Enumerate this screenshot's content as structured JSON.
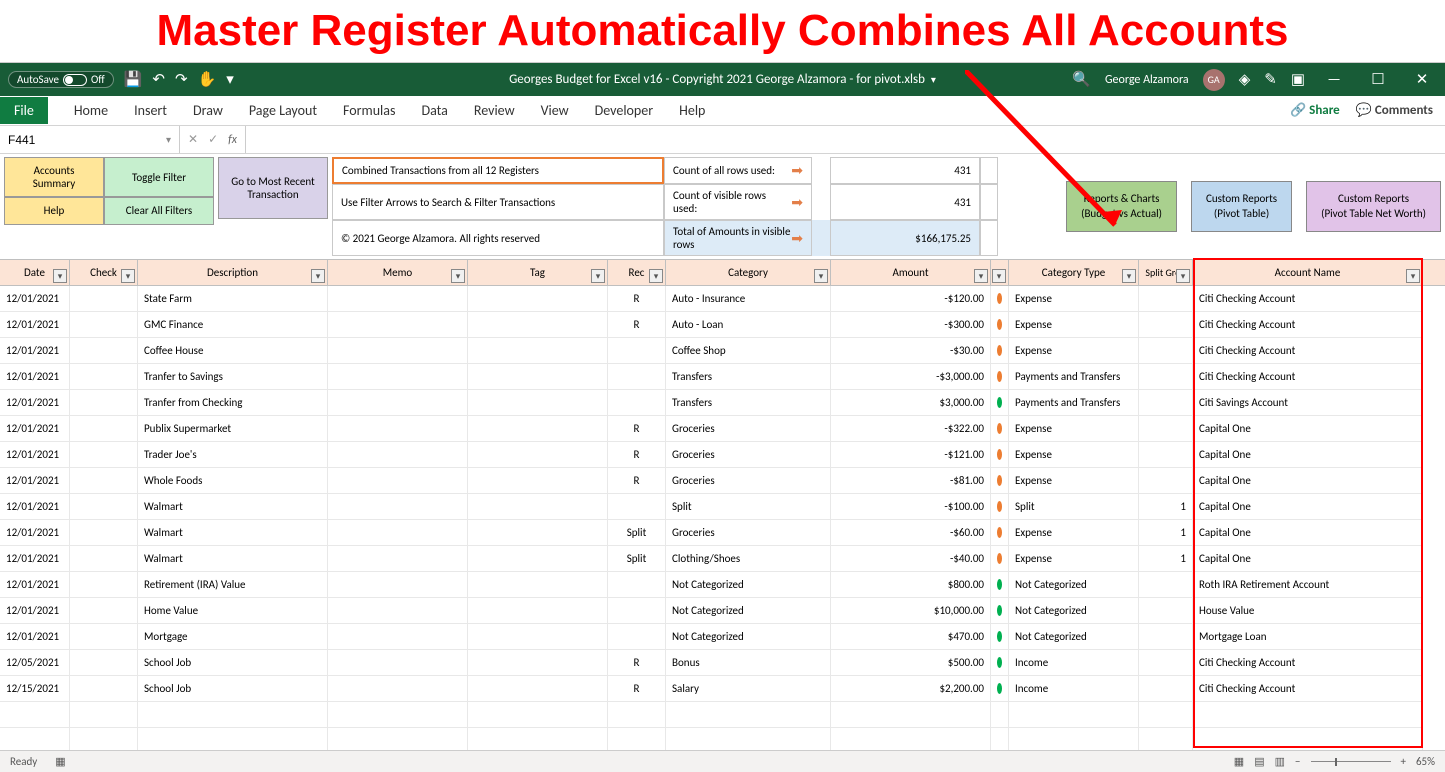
{
  "banner": "Master Register Automatically Combines All Accounts",
  "file_title": "Georges Budget for Excel v16 - Copyright 2021 George Alzamora - for pivot.xlsb",
  "user_name": "George Alzamora",
  "user_initials": "GA",
  "autosave_label": "AutoSave",
  "autosave_state": "Off",
  "ribbon": {
    "file": "File",
    "tabs": [
      "Home",
      "Insert",
      "Draw",
      "Page Layout",
      "Formulas",
      "Data",
      "Review",
      "View",
      "Developer",
      "Help"
    ],
    "share": "Share",
    "comments": "Comments"
  },
  "namebox": "F441",
  "side_buttons": {
    "accounts_summary": "Accounts\nSummary",
    "toggle_filter": "Toggle Filter",
    "help": "Help",
    "clear_filters": "Clear All Filters",
    "goto_recent": "Go to Most Recent\nTransaction"
  },
  "info": {
    "line1_left": "Combined Transactions from all 12 Registers",
    "line2_left": "Use Filter Arrows to Search & Filter Transactions",
    "line3_left": "© 2021 George Alzamora. All rights reserved",
    "count_all_label": "Count of all rows used:",
    "count_all_value": "431",
    "count_visible_label": "Count of visible rows used:",
    "count_visible_value": "431",
    "total_label": "Total of Amounts in visible rows",
    "total_value": "$166,175.25"
  },
  "report_buttons": {
    "reports_charts": "Reports & Charts\n(Budget vs Actual)",
    "custom_reports": "Custom Reports\n(Pivot Table)",
    "custom_net_worth": "Custom Reports\n(Pivot Table Net Worth)"
  },
  "columns": [
    "Date",
    "Check",
    "Description",
    "Memo",
    "Tag",
    "Rec",
    "Category",
    "Amount",
    "",
    "Category Type",
    "Split Grou",
    "Account Name"
  ],
  "rows": [
    {
      "date": "12/01/2021",
      "check": "",
      "desc": "State Farm",
      "memo": "",
      "tag": "",
      "rec": "R",
      "cat": "Auto - Insurance",
      "amt": "-$120.00",
      "dot": "red",
      "type": "Expense",
      "split": "",
      "acct": "Citi Checking Account"
    },
    {
      "date": "12/01/2021",
      "check": "",
      "desc": "GMC Finance",
      "memo": "",
      "tag": "",
      "rec": "R",
      "cat": "Auto - Loan",
      "amt": "-$300.00",
      "dot": "red",
      "type": "Expense",
      "split": "",
      "acct": "Citi Checking Account"
    },
    {
      "date": "12/01/2021",
      "check": "",
      "desc": "Coffee House",
      "memo": "",
      "tag": "",
      "rec": "",
      "cat": "Coffee Shop",
      "amt": "-$30.00",
      "dot": "red",
      "type": "Expense",
      "split": "",
      "acct": "Citi Checking Account"
    },
    {
      "date": "12/01/2021",
      "check": "",
      "desc": "Tranfer to Savings",
      "memo": "",
      "tag": "",
      "rec": "",
      "cat": "Transfers",
      "amt": "-$3,000.00",
      "dot": "red",
      "type": "Payments and Transfers",
      "split": "",
      "acct": "Citi Checking Account"
    },
    {
      "date": "12/01/2021",
      "check": "",
      "desc": "Tranfer from Checking",
      "memo": "",
      "tag": "",
      "rec": "",
      "cat": "Transfers",
      "amt": "$3,000.00",
      "dot": "green",
      "type": "Payments and Transfers",
      "split": "",
      "acct": "Citi Savings Account"
    },
    {
      "date": "12/01/2021",
      "check": "",
      "desc": "Publix Supermarket",
      "memo": "",
      "tag": "",
      "rec": "R",
      "cat": "Groceries",
      "amt": "-$322.00",
      "dot": "red",
      "type": "Expense",
      "split": "",
      "acct": "Capital One"
    },
    {
      "date": "12/01/2021",
      "check": "",
      "desc": "Trader Joe's",
      "memo": "",
      "tag": "",
      "rec": "R",
      "cat": "Groceries",
      "amt": "-$121.00",
      "dot": "red",
      "type": "Expense",
      "split": "",
      "acct": "Capital One"
    },
    {
      "date": "12/01/2021",
      "check": "",
      "desc": "Whole Foods",
      "memo": "",
      "tag": "",
      "rec": "R",
      "cat": "Groceries",
      "amt": "-$81.00",
      "dot": "red",
      "type": "Expense",
      "split": "",
      "acct": "Capital One"
    },
    {
      "date": "12/01/2021",
      "check": "",
      "desc": "Walmart",
      "memo": "",
      "tag": "",
      "rec": "",
      "cat": "Split",
      "amt": "-$100.00",
      "dot": "red",
      "type": "Split",
      "split": "1",
      "acct": "Capital One"
    },
    {
      "date": "12/01/2021",
      "check": "",
      "desc": "Walmart",
      "memo": "",
      "tag": "",
      "rec": "Split",
      "cat": "Groceries",
      "amt": "-$60.00",
      "dot": "red",
      "type": "Expense",
      "split": "1",
      "acct": "Capital One"
    },
    {
      "date": "12/01/2021",
      "check": "",
      "desc": "Walmart",
      "memo": "",
      "tag": "",
      "rec": "Split",
      "cat": "Clothing/Shoes",
      "amt": "-$40.00",
      "dot": "red",
      "type": "Expense",
      "split": "1",
      "acct": "Capital One"
    },
    {
      "date": "12/01/2021",
      "check": "",
      "desc": "Retirement (IRA) Value",
      "memo": "",
      "tag": "",
      "rec": "",
      "cat": "Not Categorized",
      "amt": "$800.00",
      "dot": "green",
      "type": "Not Categorized",
      "split": "",
      "acct": "Roth IRA Retirement Account"
    },
    {
      "date": "12/01/2021",
      "check": "",
      "desc": "Home Value",
      "memo": "",
      "tag": "",
      "rec": "",
      "cat": "Not Categorized",
      "amt": "$10,000.00",
      "dot": "green",
      "type": "Not Categorized",
      "split": "",
      "acct": "House Value"
    },
    {
      "date": "12/01/2021",
      "check": "",
      "desc": "Mortgage",
      "memo": "",
      "tag": "",
      "rec": "",
      "cat": "Not Categorized",
      "amt": "$470.00",
      "dot": "green",
      "type": "Not Categorized",
      "split": "",
      "acct": "Mortgage Loan"
    },
    {
      "date": "12/05/2021",
      "check": "",
      "desc": "School Job",
      "memo": "",
      "tag": "",
      "rec": "R",
      "cat": "Bonus",
      "amt": "$500.00",
      "dot": "green",
      "type": "Income",
      "split": "",
      "acct": "Citi Checking Account"
    },
    {
      "date": "12/15/2021",
      "check": "",
      "desc": "School Job",
      "memo": "",
      "tag": "",
      "rec": "R",
      "cat": "Salary",
      "amt": "$2,200.00",
      "dot": "green",
      "type": "Income",
      "split": "",
      "acct": "Citi Checking Account"
    }
  ],
  "status": {
    "ready": "Ready",
    "zoom": "65%"
  }
}
